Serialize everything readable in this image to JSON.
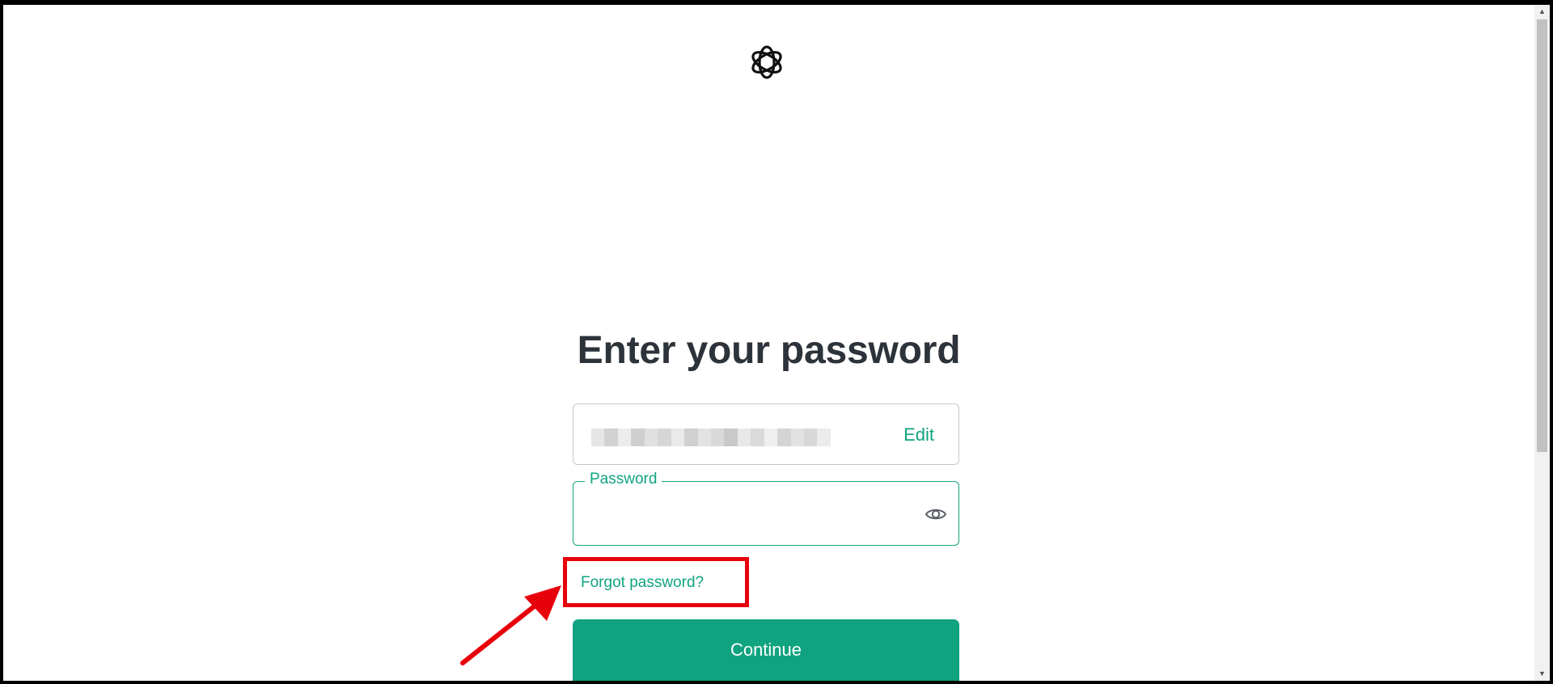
{
  "page": {
    "heading": "Enter your password"
  },
  "logo": {
    "icon": "openai-logo-icon"
  },
  "email_field": {
    "value_state": "blurred",
    "edit_label": "Edit"
  },
  "password_field": {
    "label": "Password",
    "value": "",
    "toggle_icon": "eye-icon"
  },
  "forgot_password": {
    "label": "Forgot password?"
  },
  "continue_button": {
    "label": "Continue"
  },
  "annotation": {
    "highlight_color": "#e8000b",
    "arrow_icon": "red-arrow-icon"
  },
  "colors": {
    "accent": "#10a37f",
    "heading": "#2d333a",
    "border": "#c2c8d0"
  }
}
